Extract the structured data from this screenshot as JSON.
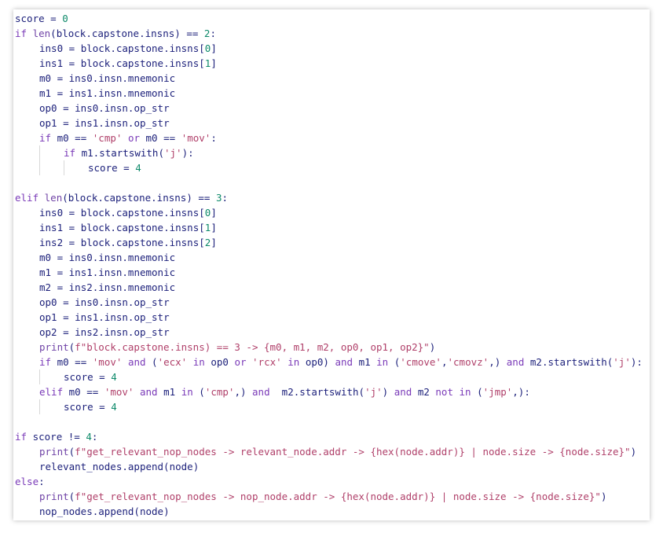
{
  "editor": {
    "lines": [
      {
        "indent": 0,
        "guides": [],
        "text": "score = 0"
      },
      {
        "indent": 0,
        "guides": [],
        "text": "if len(block.capstone.insns) == 2:"
      },
      {
        "indent": 1,
        "guides": [],
        "text": "ins0 = block.capstone.insns[0]"
      },
      {
        "indent": 1,
        "guides": [],
        "text": "ins1 = block.capstone.insns[1]"
      },
      {
        "indent": 1,
        "guides": [],
        "text": "m0 = ins0.insn.mnemonic"
      },
      {
        "indent": 1,
        "guides": [],
        "text": "m1 = ins1.insn.mnemonic"
      },
      {
        "indent": 1,
        "guides": [],
        "text": "op0 = ins0.insn.op_str"
      },
      {
        "indent": 1,
        "guides": [],
        "text": "op1 = ins1.insn.op_str"
      },
      {
        "indent": 1,
        "guides": [],
        "text": "if m0 == 'cmp' or m0 == 'mov':"
      },
      {
        "indent": 2,
        "guides": [
          1
        ],
        "text": "if m1.startswith('j'):"
      },
      {
        "indent": 3,
        "guides": [
          1,
          2
        ],
        "text": "score = 4"
      },
      {
        "indent": 0,
        "guides": [],
        "text": ""
      },
      {
        "indent": 0,
        "guides": [],
        "text": "elif len(block.capstone.insns) == 3:"
      },
      {
        "indent": 1,
        "guides": [],
        "text": "ins0 = block.capstone.insns[0]"
      },
      {
        "indent": 1,
        "guides": [],
        "text": "ins1 = block.capstone.insns[1]"
      },
      {
        "indent": 1,
        "guides": [],
        "text": "ins2 = block.capstone.insns[2]"
      },
      {
        "indent": 1,
        "guides": [],
        "text": "m0 = ins0.insn.mnemonic"
      },
      {
        "indent": 1,
        "guides": [],
        "text": "m1 = ins1.insn.mnemonic"
      },
      {
        "indent": 1,
        "guides": [],
        "text": "m2 = ins2.insn.mnemonic"
      },
      {
        "indent": 1,
        "guides": [],
        "text": "op0 = ins0.insn.op_str"
      },
      {
        "indent": 1,
        "guides": [],
        "text": "op1 = ins1.insn.op_str"
      },
      {
        "indent": 1,
        "guides": [],
        "text": "op2 = ins2.insn.op_str"
      },
      {
        "indent": 1,
        "guides": [],
        "text": "print(f\"block.capstone.insns) == 3 -> {m0, m1, m2, op0, op1, op2}\")"
      },
      {
        "indent": 1,
        "guides": [],
        "text": "if m0 == 'mov' and ('ecx' in op0 or 'rcx' in op0) and m1 in ('cmove','cmovz',) and m2.startswith('j'):"
      },
      {
        "indent": 2,
        "guides": [
          1
        ],
        "text": "score = 4"
      },
      {
        "indent": 1,
        "guides": [],
        "text": "elif m0 == 'mov' and m1 in ('cmp',) and  m2.startswith('j') and m2 not in ('jmp',):"
      },
      {
        "indent": 2,
        "guides": [
          1
        ],
        "text": "score = 4"
      },
      {
        "indent": 0,
        "guides": [],
        "text": ""
      },
      {
        "indent": 0,
        "guides": [],
        "text": "if score != 4:"
      },
      {
        "indent": 1,
        "guides": [],
        "text": "print(f\"get_relevant_nop_nodes -> relevant_node.addr -> {hex(node.addr)} | node.size -> {node.size}\")"
      },
      {
        "indent": 1,
        "guides": [],
        "text": "relevant_nodes.append(node)"
      },
      {
        "indent": 0,
        "guides": [],
        "text": "else:"
      },
      {
        "indent": 1,
        "guides": [],
        "text": "print(f\"get_relevant_nop_nodes -> nop_node.addr -> {hex(node.addr)} | node.size -> {node.size}\")"
      },
      {
        "indent": 1,
        "guides": [],
        "text": "nop_nodes.append(node)"
      }
    ]
  }
}
